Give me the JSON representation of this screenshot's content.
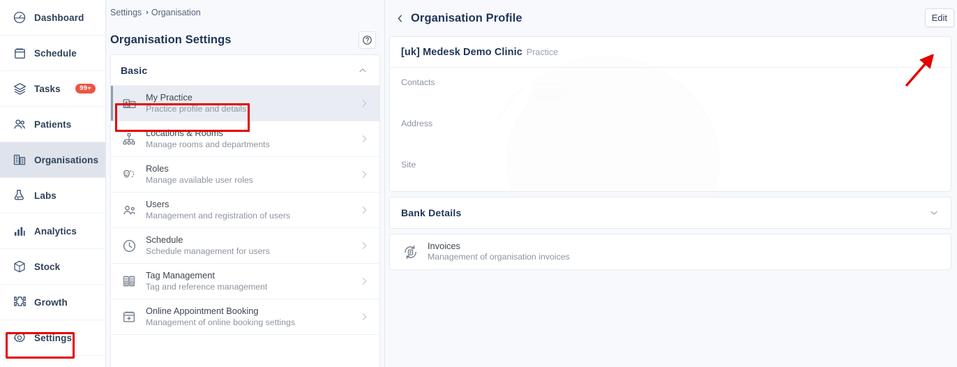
{
  "sidebar": {
    "items": [
      {
        "label": "Dashboard",
        "icon": "dashboard-icon",
        "active": false,
        "badge": null
      },
      {
        "label": "Schedule",
        "icon": "calendar-icon",
        "active": false,
        "badge": null
      },
      {
        "label": "Tasks",
        "icon": "layers-icon",
        "active": false,
        "badge": "99+"
      },
      {
        "label": "Patients",
        "icon": "people-icon",
        "active": false,
        "badge": null
      },
      {
        "label": "Organisations",
        "icon": "building-icon",
        "active": true,
        "badge": null
      },
      {
        "label": "Labs",
        "icon": "flask-icon",
        "active": false,
        "badge": null
      },
      {
        "label": "Analytics",
        "icon": "bar-chart-icon",
        "active": false,
        "badge": null
      },
      {
        "label": "Stock",
        "icon": "box-icon",
        "active": false,
        "badge": null
      },
      {
        "label": "Growth",
        "icon": "puzzle-icon",
        "active": false,
        "badge": null
      },
      {
        "label": "Settings",
        "icon": "gear-icon",
        "active": false,
        "badge": null
      }
    ]
  },
  "breadcrumb": {
    "root": "Settings",
    "separator": "›",
    "current": "Organisation"
  },
  "middle": {
    "title": "Organisation Settings",
    "help_icon": "question-circle-icon",
    "section": {
      "label": "Basic",
      "collapse_icon": "chevron-up-icon"
    },
    "rows": [
      {
        "title": "My Practice",
        "subtitle": "Practice profile and details",
        "icon": "practice-building-icon",
        "selected": true
      },
      {
        "title": "Locations & Rooms",
        "subtitle": "Manage rooms and departments",
        "icon": "sitemap-icon",
        "selected": false
      },
      {
        "title": "Roles",
        "subtitle": "Manage available user roles",
        "icon": "masks-icon",
        "selected": false
      },
      {
        "title": "Users",
        "subtitle": "Management and registration of users",
        "icon": "users-icon",
        "selected": false
      },
      {
        "title": "Schedule",
        "subtitle": "Schedule management for users",
        "icon": "clock-icon",
        "selected": false
      },
      {
        "title": "Tag Management",
        "subtitle": "Tag and reference management",
        "icon": "binders-icon",
        "selected": false
      },
      {
        "title": "Online Appointment Booking",
        "subtitle": "Management of online booking settings",
        "icon": "calendar-plus-icon",
        "selected": false
      }
    ]
  },
  "right": {
    "back_icon": "chevron-left-icon",
    "title": "Organisation Profile",
    "edit_label": "Edit",
    "profile": {
      "org_name": "[uk] Medesk Demo Clinic",
      "org_type": "Practice",
      "fields": [
        {
          "label": "Contacts",
          "value": ""
        },
        {
          "label": "Address",
          "value": ""
        },
        {
          "label": "Site",
          "value": ""
        }
      ]
    },
    "bank": {
      "title": "Bank Details",
      "expand_icon": "chevron-down-icon"
    },
    "invoices": {
      "title": "Invoices",
      "subtitle": "Management of organisation invoices",
      "icon": "invoice-refresh-icon"
    }
  },
  "annotations": {
    "arrow_color": "#e40000",
    "highlight_color": "#e40000",
    "highlighted_elements": [
      "sidebar-item-settings",
      "row-my-practice"
    ],
    "arrow_points_to": "edit-button"
  },
  "colors": {
    "accent": "#1f3557",
    "badge": "#ec5542",
    "active_nav_bg": "#dfe4ec",
    "page_bg": "#f7f9fc",
    "card_bg": "#ffffff"
  }
}
